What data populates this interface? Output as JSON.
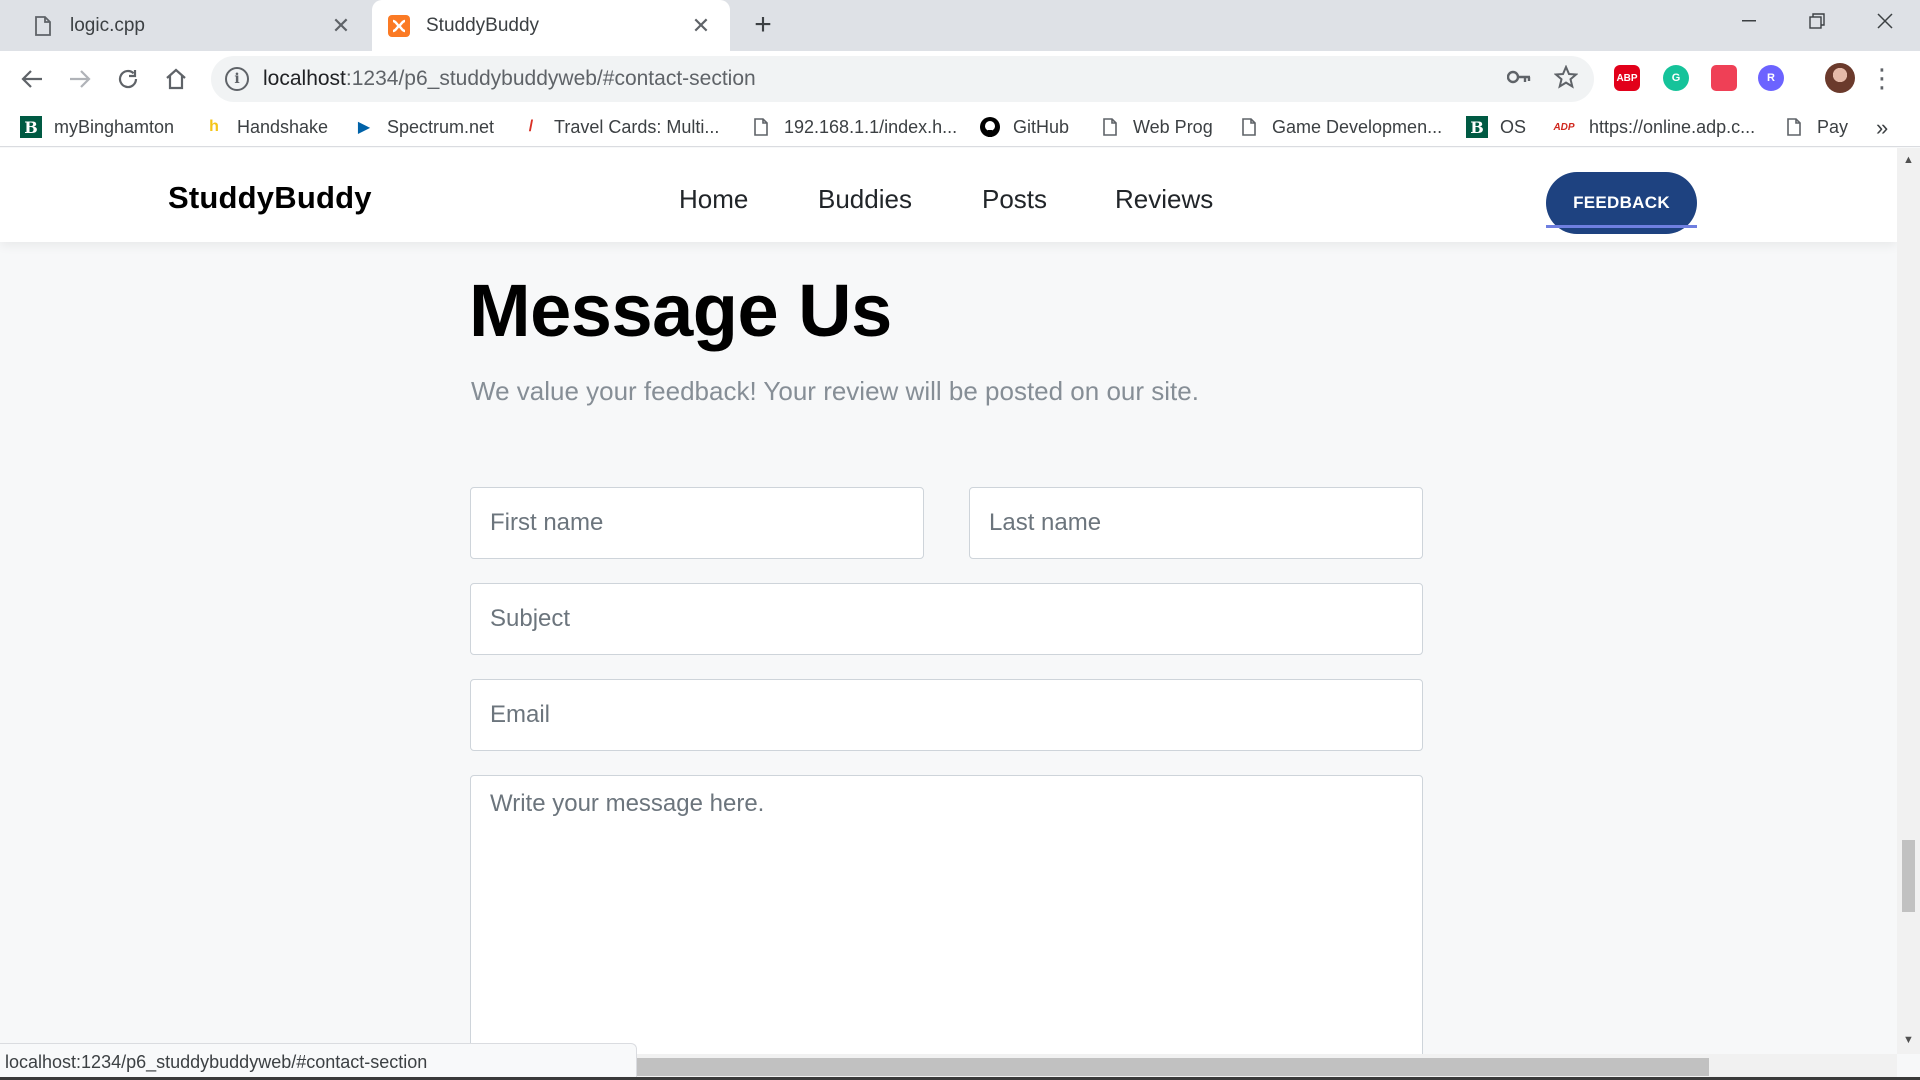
{
  "browser": {
    "tabs": [
      {
        "title": "logic.cpp",
        "icon": "document-icon"
      },
      {
        "title": "StuddyBuddy",
        "icon": "xampp-icon"
      }
    ],
    "url_host": "localhost",
    "url_path": ":1234/p6_studdybuddyweb/#contact-section",
    "bookmarks": [
      {
        "label": "myBinghamton",
        "icon": "binghamton-b-icon",
        "color": "#005a43"
      },
      {
        "label": "Handshake",
        "icon": "handshake-icon",
        "color": "#f5c518"
      },
      {
        "label": "Spectrum.net",
        "icon": "spectrum-play-icon",
        "color": "#0062a8"
      },
      {
        "label": "Travel Cards: Multi...",
        "icon": "slash-icon",
        "color": "#d93025"
      },
      {
        "label": "192.168.1.1/index.h...",
        "icon": "document-icon",
        "color": "#5f6368"
      },
      {
        "label": "GitHub",
        "icon": "github-icon",
        "color": "#000000"
      },
      {
        "label": "Web Prog",
        "icon": "document-icon",
        "color": "#5f6368"
      },
      {
        "label": "Game Developmen...",
        "icon": "document-icon",
        "color": "#5f6368"
      },
      {
        "label": "OS",
        "icon": "binghamton-b-icon",
        "color": "#005a43"
      },
      {
        "label": "https://online.adp.c...",
        "icon": "adp-icon",
        "color": "#d0271d"
      },
      {
        "label": "Pay",
        "icon": "document-icon",
        "color": "#5f6368"
      }
    ],
    "extensions": [
      {
        "name": "adblock-plus-icon",
        "label": "ABP",
        "color": "#e2001a"
      },
      {
        "name": "grammarly-icon",
        "label": "G",
        "color": "#15c39a"
      },
      {
        "name": "pocket-icon",
        "label": "",
        "color": "#ef4056"
      },
      {
        "name": "r-extension-icon",
        "label": "R",
        "color": "#6c63ff"
      }
    ],
    "status_url": "localhost:1234/p6_studdybuddyweb/#contact-section"
  },
  "site": {
    "brand": "StuddyBuddy",
    "nav": [
      "Home",
      "Buddies",
      "Posts",
      "Reviews"
    ],
    "feedback_button": "FEEDBACK",
    "accent_color": "#1e4280"
  },
  "contact": {
    "heading": "Message Us",
    "subtext": "We value your feedback! Your review will be posted on our site.",
    "first_name_placeholder": "First name",
    "last_name_placeholder": "Last name",
    "subject_placeholder": "Subject",
    "email_placeholder": "Email",
    "message_placeholder": "Write your message here."
  }
}
